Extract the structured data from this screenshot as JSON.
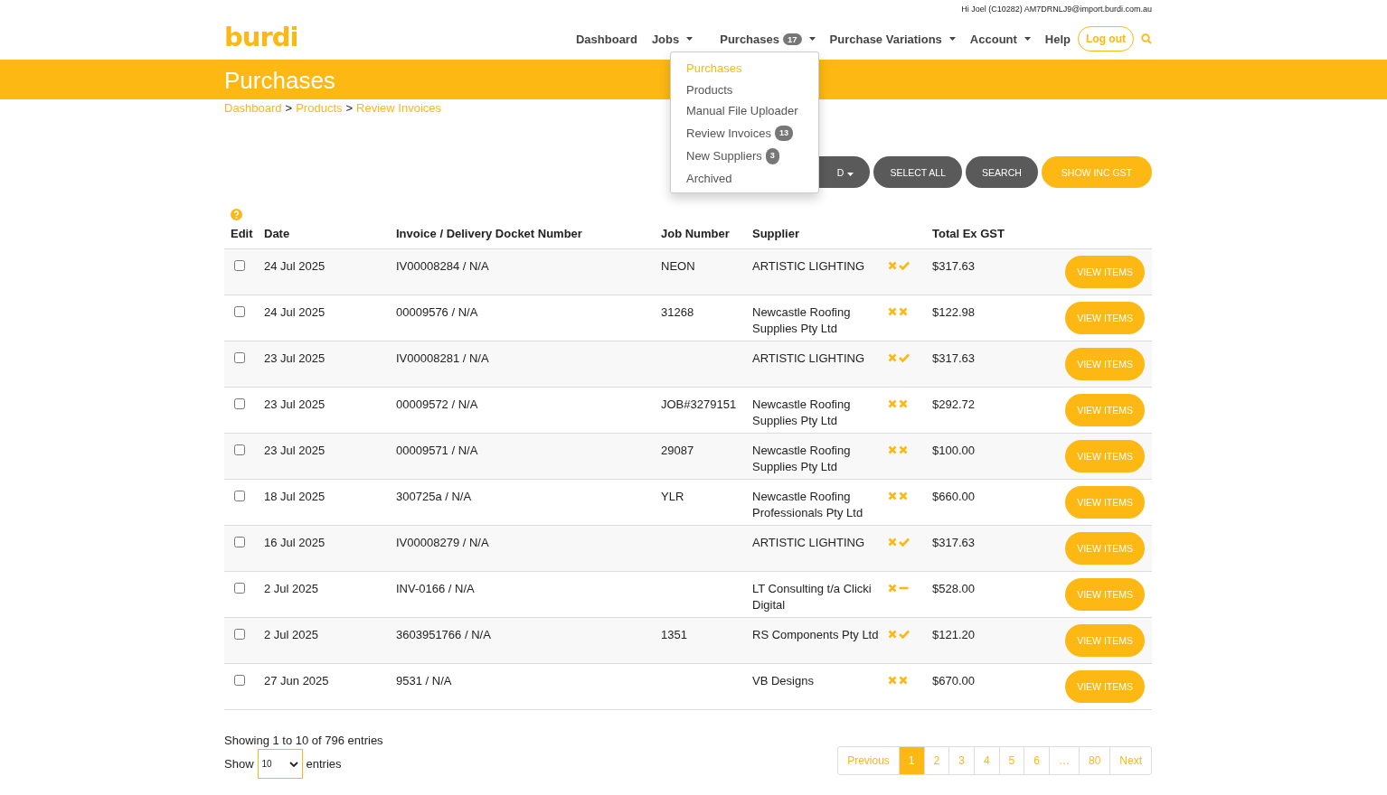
{
  "top_bar": {
    "greeting": "Hi Joel (C10282) AM7DRNLJ9@import.burdi.com.au"
  },
  "logo": "burdi",
  "nav": [
    {
      "label": "Dashboard",
      "dropdown": false
    },
    {
      "label": "Jobs",
      "dropdown": true
    },
    {
      "label": "Purchases",
      "badge": "17",
      "dropdown": true
    },
    {
      "label": "Purchase Variations",
      "dropdown": true
    },
    {
      "label": "Account",
      "dropdown": true
    },
    {
      "label": "Help",
      "dropdown": false
    }
  ],
  "logout": "Log out",
  "menu": [
    {
      "label": "Purchases",
      "selected": true
    },
    {
      "label": "Products",
      "selected": false
    },
    {
      "label": "Manual File Uploader",
      "selected": false
    },
    {
      "label": "Review Invoices",
      "badge": "13",
      "selected": false
    },
    {
      "label": "New Suppliers",
      "badge": "3",
      "selected": false
    },
    {
      "label": "Archived",
      "selected": false
    }
  ],
  "page_title": "Purchases",
  "breadcrumb": [
    {
      "kind": "link",
      "label": "Dashboard"
    },
    {
      "kind": "separator",
      "label": ">"
    },
    {
      "kind": "link",
      "label": "Products"
    },
    {
      "kind": "separator",
      "label": ">"
    },
    {
      "kind": "link",
      "label": "Review Invoices"
    }
  ],
  "actions": [
    {
      "kind": "blank"
    },
    {
      "kind": "dropdown",
      "label": "D"
    },
    {
      "kind": "dark",
      "label": "SELECT ALL"
    },
    {
      "kind": "dark",
      "label": "SEARCH"
    },
    {
      "kind": "accent",
      "label": "SHOW INC GST"
    }
  ],
  "table": {
    "columns": [
      "Edit",
      "Date",
      "Invoice / Delivery Docket Number",
      "Job Number",
      "Supplier",
      "Total Ex GST"
    ],
    "rows": [
      {
        "checked": false,
        "date": "24 Jul 2025",
        "invoice": "IV00008284 / N/A",
        "job": "NEON",
        "supplier": "ARTISTIC LIGHTING",
        "status": [
          {
            "kind": "cross"
          },
          {
            "kind": "check"
          }
        ],
        "total": "$317.63",
        "button": "VIEW ITEMS"
      },
      {
        "checked": false,
        "date": "24 Jul 2025",
        "invoice": "00009576 / N/A",
        "job": "31268",
        "supplier": "Newcastle Roofing Supplies Pty Ltd",
        "status": [
          {
            "kind": "cross"
          },
          {
            "kind": "cross"
          }
        ],
        "total": "$122.98",
        "button": "VIEW ITEMS"
      },
      {
        "checked": false,
        "date": "23 Jul 2025",
        "invoice": "IV00008281 / N/A",
        "supplier": "ARTISTIC LIGHTING",
        "status": [
          {
            "kind": "cross"
          },
          {
            "kind": "check"
          }
        ],
        "total": "$317.63",
        "button": "VIEW ITEMS"
      },
      {
        "checked": false,
        "date": "23 Jul 2025",
        "invoice": "00009572 / N/A",
        "job": "JOB#3279151",
        "supplier": "Newcastle Roofing Supplies Pty Ltd",
        "status": [
          {
            "kind": "cross"
          },
          {
            "kind": "cross"
          }
        ],
        "total": "$292.72",
        "button": "VIEW ITEMS"
      },
      {
        "checked": false,
        "date": "23 Jul 2025",
        "invoice": "00009571 / N/A",
        "job": "29087",
        "supplier": "Newcastle Roofing Supplies Pty Ltd",
        "status": [
          {
            "kind": "cross"
          },
          {
            "kind": "cross"
          }
        ],
        "total": "$100.00",
        "button": "VIEW ITEMS"
      },
      {
        "checked": false,
        "date": "18 Jul 2025",
        "invoice": "300725a / N/A",
        "job": "YLR",
        "supplier": "Newcastle Roofing Professionals Pty Ltd",
        "status": [
          {
            "kind": "cross"
          },
          {
            "kind": "cross"
          }
        ],
        "total": "$660.00",
        "button": "VIEW ITEMS"
      },
      {
        "checked": false,
        "date": "16 Jul 2025",
        "invoice": "IV00008279 / N/A",
        "supplier": "ARTISTIC LIGHTING",
        "status": [
          {
            "kind": "cross"
          },
          {
            "kind": "check"
          }
        ],
        "total": "$317.63",
        "button": "VIEW ITEMS"
      },
      {
        "checked": false,
        "date": "2 Jul 2025",
        "invoice": "INV-0166 / N/A",
        "supplier": "LT Consulting t/a Clicki Digital",
        "status": [
          {
            "kind": "cross"
          },
          {
            "kind": "dash"
          }
        ],
        "total": "$528.00",
        "button": "VIEW ITEMS"
      },
      {
        "checked": false,
        "date": "2 Jul 2025",
        "invoice": "3603951766 / N/A",
        "job": "1351",
        "supplier": "RS Components Pty Ltd",
        "status": [
          {
            "kind": "cross"
          },
          {
            "kind": "check"
          }
        ],
        "total": "$121.20",
        "button": "VIEW ITEMS"
      },
      {
        "checked": false,
        "date": "27 Jun 2025",
        "invoice": "9531 / N/A",
        "supplier": "VB Designs",
        "status": [
          {
            "kind": "cross"
          },
          {
            "kind": "cross"
          }
        ],
        "total": "$670.00",
        "button": "VIEW ITEMS"
      }
    ]
  },
  "info": "Showing 1 to 10 of 796 entries",
  "length": {
    "before": "Show",
    "value": "10",
    "after": "entries"
  },
  "pagination": [
    {
      "label": "Previous",
      "selected": false
    },
    {
      "label": "1",
      "selected": true
    },
    {
      "label": "2",
      "selected": false
    },
    {
      "label": "3",
      "selected": false
    },
    {
      "label": "4",
      "selected": false
    },
    {
      "label": "5",
      "selected": false
    },
    {
      "label": "6",
      "selected": false
    },
    {
      "label": "…",
      "selected": false
    },
    {
      "label": "80",
      "selected": false
    },
    {
      "label": "Next",
      "selected": false
    }
  ]
}
